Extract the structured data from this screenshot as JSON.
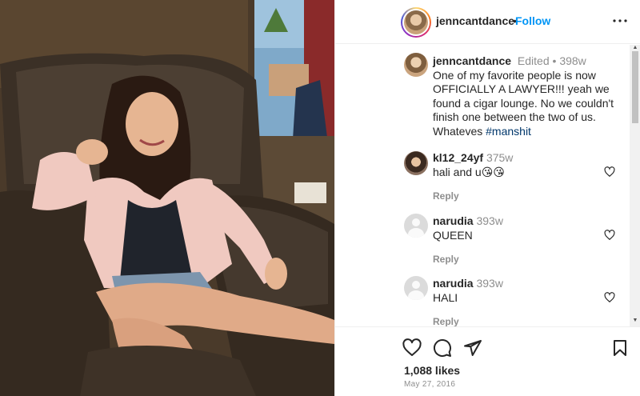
{
  "post": {
    "username": "jenncantdance",
    "follow_label": "Follow",
    "header_dot": "•",
    "caption": {
      "username": "jenncantdance",
      "edited": "Edited",
      "dot": "•",
      "time": "398w",
      "text": "One of my favorite people is now OFFICIALLY A LAWYER!!! yeah we found a cigar lounge. No we couldn't finish one between the two of us. Whateves ",
      "hashtag": "#manshit"
    },
    "comments": [
      {
        "username": "kl12_24yf",
        "time": "375w",
        "text": "hali and u😘😘",
        "reply_label": "Reply"
      },
      {
        "username": "narudia",
        "time": "393w",
        "text": "QUEEN",
        "reply_label": "Reply"
      },
      {
        "username": "narudia",
        "time": "393w",
        "text": "HALI",
        "reply_label": "Reply"
      }
    ],
    "likes": "1,088 likes",
    "date": "May 27, 2016"
  },
  "colors": {
    "accent": "#0095f6",
    "text": "#262626",
    "muted": "#8e8e8e",
    "hashtag": "#00376b",
    "border": "#efefef"
  },
  "icons": {
    "more": "more-horizontal-icon",
    "like": "heart-icon",
    "comment": "comment-bubble-icon",
    "share": "paper-plane-icon",
    "save": "bookmark-icon",
    "comment_like": "heart-small-icon"
  }
}
